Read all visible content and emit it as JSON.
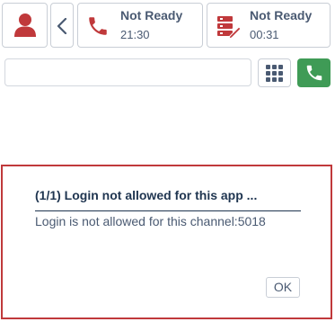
{
  "toolbar": {
    "user_icon": "user-icon",
    "back_icon": "chevron-left-icon",
    "voice_status": {
      "icon": "phone-icon",
      "title": "Not Ready",
      "time": "21:30"
    },
    "work_status": {
      "icon": "work-item-icon",
      "title": "Not Ready",
      "time": "00:31"
    }
  },
  "dial": {
    "input_value": "",
    "placeholder": "",
    "keypad_icon": "keypad-icon",
    "call_icon": "phone-icon"
  },
  "dialog": {
    "title": "(1/1) Login not allowed for this app ...",
    "message": "Login is not allowed for this channel:5018",
    "ok_label": "OK"
  },
  "colors": {
    "accent_red": "#c0393b",
    "call_green": "#3f9b56",
    "text": "#4a5a72",
    "dialog_title": "#1f3550",
    "border": "#c9ced6"
  }
}
